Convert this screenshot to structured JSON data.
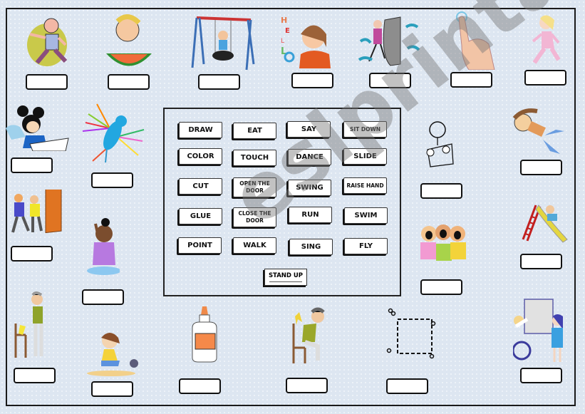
{
  "worksheet": {
    "word_bank": {
      "rows": [
        [
          "DRAW",
          "EAT",
          "SAY",
          "SIT DOWN"
        ],
        [
          "COLOR",
          "TOUCH",
          "DANCE",
          "SLIDE"
        ],
        [
          "CUT",
          "OPEN THE DOOR",
          "SWING",
          "RAISE HAND"
        ],
        [
          "GLUE",
          "CLOSE THE DOOR",
          "RUN",
          "SWIM"
        ],
        [
          "POINT",
          "WALK",
          "SING",
          "FLY"
        ]
      ],
      "extra": "STAND UP"
    },
    "pictures": [
      {
        "name": "run",
        "depicts": "girl running"
      },
      {
        "name": "eat",
        "depicts": "boy eating watermelon"
      },
      {
        "name": "swing",
        "depicts": "child on tire swing"
      },
      {
        "name": "say",
        "depicts": "girl saying hello"
      },
      {
        "name": "open-the-door",
        "depicts": "girl opening door"
      },
      {
        "name": "touch",
        "depicts": "finger touching"
      },
      {
        "name": "walk",
        "depicts": "girl walking"
      },
      {
        "name": "draw",
        "depicts": "mickey drawing"
      },
      {
        "name": "fly",
        "depicts": "colorful bird flying"
      },
      {
        "name": "color",
        "depicts": "stick figure coloring"
      },
      {
        "name": "swim",
        "depicts": "girl swimming"
      },
      {
        "name": "close-the-door",
        "depicts": "people closing door"
      },
      {
        "name": "dance",
        "depicts": "girl raising hand sitting"
      },
      {
        "name": "sing",
        "depicts": "three kids singing"
      },
      {
        "name": "slide",
        "depicts": "child on slide"
      },
      {
        "name": "stand-up",
        "depicts": "man standing up from chair"
      },
      {
        "name": "dance-kick",
        "depicts": "girl dancing"
      },
      {
        "name": "glue",
        "depicts": "glue bottle"
      },
      {
        "name": "sit-down",
        "depicts": "boy sitting down"
      },
      {
        "name": "cut",
        "depicts": "scissors cutting square"
      },
      {
        "name": "point",
        "depicts": "kids pointing at board"
      }
    ],
    "watermark": "eslprintables.com"
  }
}
